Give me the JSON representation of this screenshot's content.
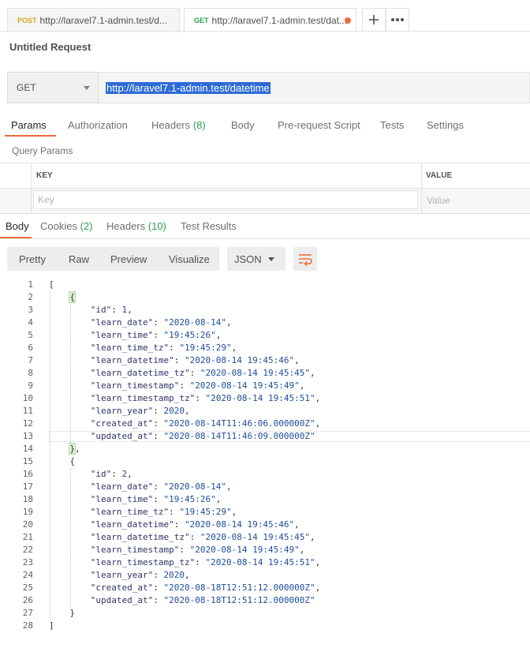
{
  "tabs": [
    {
      "method": "POST",
      "url": "http://laravel7.1-admin.test/d..."
    },
    {
      "method": "GET",
      "url": "http://laravel7.1-admin.test/dat..."
    }
  ],
  "request": {
    "title": "Untitled Request",
    "method": "GET",
    "url": "http://laravel7.1-admin.test/datetime"
  },
  "request_tabs": [
    {
      "label": "Params",
      "count": ""
    },
    {
      "label": "Authorization",
      "count": ""
    },
    {
      "label": "Headers",
      "count": "(8)"
    },
    {
      "label": "Body",
      "count": ""
    },
    {
      "label": "Pre-request Script",
      "count": ""
    },
    {
      "label": "Tests",
      "count": ""
    },
    {
      "label": "Settings",
      "count": ""
    }
  ],
  "query_params": {
    "title": "Query Params",
    "key_header": "KEY",
    "value_header": "VALUE",
    "key_placeholder": "Key",
    "value_placeholder": "Value"
  },
  "response_tabs": [
    {
      "label": "Body",
      "count": ""
    },
    {
      "label": "Cookies",
      "count": "(2)"
    },
    {
      "label": "Headers",
      "count": "(10)"
    },
    {
      "label": "Test Results",
      "count": ""
    }
  ],
  "view_buttons": [
    "Pretty",
    "Raw",
    "Preview",
    "Visualize"
  ],
  "format": "JSON",
  "icons": {
    "add": "plus-icon",
    "more": "more-dots-icon",
    "wrap": "wrap-lines-icon"
  },
  "colors": {
    "accent": "#f26b3a",
    "get": "#2e9e4e",
    "post": "#d9a81d",
    "selection": "#2d6bd6"
  },
  "response_body": [
    {
      "id": 1,
      "learn_date": "2020-08-14",
      "learn_time": "19:45:26",
      "learn_time_tz": "19:45:29",
      "learn_datetime": "2020-08-14 19:45:46",
      "learn_datetime_tz": "2020-08-14 19:45:45",
      "learn_timestamp": "2020-08-14 19:45:49",
      "learn_timestamp_tz": "2020-08-14 19:45:51",
      "learn_year": 2020,
      "created_at": "2020-08-14T11:46:06.000000Z",
      "updated_at": "2020-08-14T11:46:09.000000Z"
    },
    {
      "id": 2,
      "learn_date": "2020-08-14",
      "learn_time": "19:45:26",
      "learn_time_tz": "19:45:29",
      "learn_datetime": "2020-08-14 19:45:46",
      "learn_datetime_tz": "2020-08-14 19:45:45",
      "learn_timestamp": "2020-08-14 19:45:49",
      "learn_timestamp_tz": "2020-08-14 19:45:51",
      "learn_year": 2020,
      "created_at": "2020-08-18T12:51:12.000000Z",
      "updated_at": "2020-08-18T12:51:12.000000Z"
    }
  ]
}
